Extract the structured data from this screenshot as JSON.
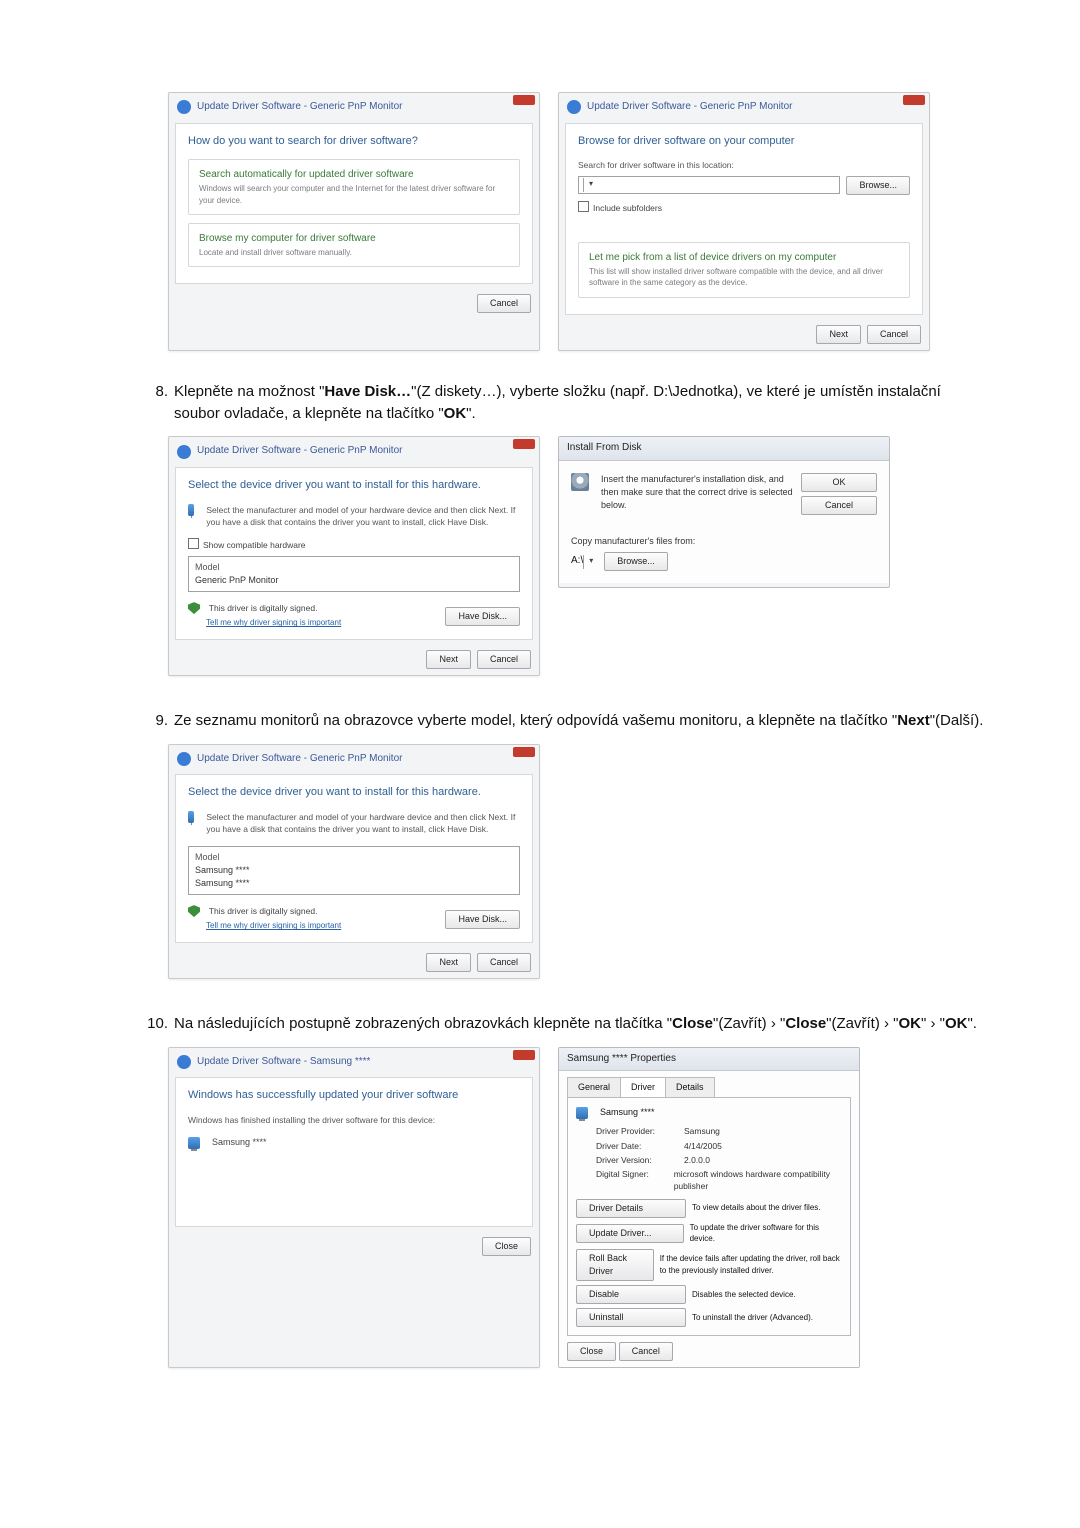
{
  "steps": {
    "eight": {
      "num": "8.",
      "text_prefix": "Klepněte na možnost \"",
      "have_disk": "Have Disk…",
      "text_mid1": "\"(Z diskety…), vyberte složku (např. D:\\Jednotka), ve které je umístěn instalační soubor ovladače, a klepněte na tlačítko \"",
      "ok": "OK",
      "text_end": "\"."
    },
    "nine": {
      "num": "9.",
      "text_prefix": "Ze seznamu monitorů na obrazovce vyberte model, který odpovídá vašemu monitoru, a klepněte na tlačítko \"",
      "next": "Next",
      "text_mid": "\"(Další)."
    },
    "ten": {
      "num": "10.",
      "text_prefix": "Na následujících postupně zobrazených obrazovkách klepněte na tlačítka \"",
      "close1": "Close",
      "text_m1": "\"(Zavřít) › \"",
      "close2": "Close",
      "text_m2": "\"(Zavřít) › \"",
      "ok1": "OK",
      "text_m3": "\" › \"",
      "ok2": "OK",
      "text_end": "\"."
    }
  },
  "dlg_search": {
    "title": "Update Driver Software - Generic PnP Monitor",
    "heading": "How do you want to search for driver software?",
    "opt1_title": "Search automatically for updated driver software",
    "opt1_sub": "Windows will search your computer and the Internet for the latest driver software for your device.",
    "opt2_title": "Browse my computer for driver software",
    "opt2_sub": "Locate and install driver software manually.",
    "cancel": "Cancel"
  },
  "dlg_browse": {
    "title": "Update Driver Software - Generic PnP Monitor",
    "heading": "Browse for driver software on your computer",
    "label": "Search for driver software in this location:",
    "path": "",
    "browse": "Browse...",
    "include": "Include subfolders",
    "opt_title": "Let me pick from a list of device drivers on my computer",
    "opt_sub": "This list will show installed driver software compatible with the device, and all driver software in the same category as the device.",
    "next": "Next",
    "cancel": "Cancel"
  },
  "dlg_select1": {
    "title": "Update Driver Software - Generic PnP Monitor",
    "heading": "Select the device driver you want to install for this hardware.",
    "desc": "Select the manufacturer and model of your hardware device and then click Next. If you have a disk that contains the driver you want to install, click Have Disk.",
    "show": "Show compatible hardware",
    "model_h": "Model",
    "model_1": "Generic PnP Monitor",
    "signed": "This driver is digitally signed.",
    "tell": "Tell me why driver signing is important",
    "have_disk": "Have Disk...",
    "next": "Next",
    "cancel": "Cancel"
  },
  "dlg_install_from_disk": {
    "tbar": "Install From Disk",
    "msg": "Insert the manufacturer's installation disk, and then make sure that the correct drive is selected below.",
    "ok": "OK",
    "cancel": "Cancel",
    "copy": "Copy manufacturer's files from:",
    "path": "A:\\",
    "browse": "Browse..."
  },
  "dlg_select2": {
    "title": "Update Driver Software - Generic PnP Monitor",
    "heading": "Select the device driver you want to install for this hardware.",
    "desc": "Select the manufacturer and model of your hardware device and then click Next. If you have a disk that contains the driver you want to install, click Have Disk.",
    "model_h": "Model",
    "model_1": "Samsung ****",
    "model_2": "Samsung ****",
    "signed": "This driver is digitally signed.",
    "tell": "Tell me why driver signing is important",
    "have_disk": "Have Disk...",
    "next": "Next",
    "cancel": "Cancel"
  },
  "dlg_done": {
    "title": "Update Driver Software - Samsung ****",
    "heading": "Windows has successfully updated your driver software",
    "sub": "Windows has finished installing the driver software for this device:",
    "model": "Samsung ****",
    "close": "Close"
  },
  "dlg_props": {
    "tbar": "Samsung **** Properties",
    "tabs": {
      "general": "General",
      "driver": "Driver",
      "details": "Details"
    },
    "model": "Samsung ****",
    "provider_k": "Driver Provider:",
    "provider_v": "Samsung",
    "date_k": "Driver Date:",
    "date_v": "4/14/2005",
    "ver_k": "Driver Version:",
    "ver_v": "2.0.0.0",
    "signer_k": "Digital Signer:",
    "signer_v": "microsoft windows hardware compatibility publisher",
    "b_details": "Driver Details",
    "b_details_d": "To view details about the driver files.",
    "b_update": "Update Driver...",
    "b_update_d": "To update the driver software for this device.",
    "b_roll": "Roll Back Driver",
    "b_roll_d": "If the device fails after updating the driver, roll back to the previously installed driver.",
    "b_disable": "Disable",
    "b_disable_d": "Disables the selected device.",
    "b_uninstall": "Uninstall",
    "b_uninstall_d": "To uninstall the driver (Advanced).",
    "close": "Close",
    "cancel": "Cancel"
  }
}
